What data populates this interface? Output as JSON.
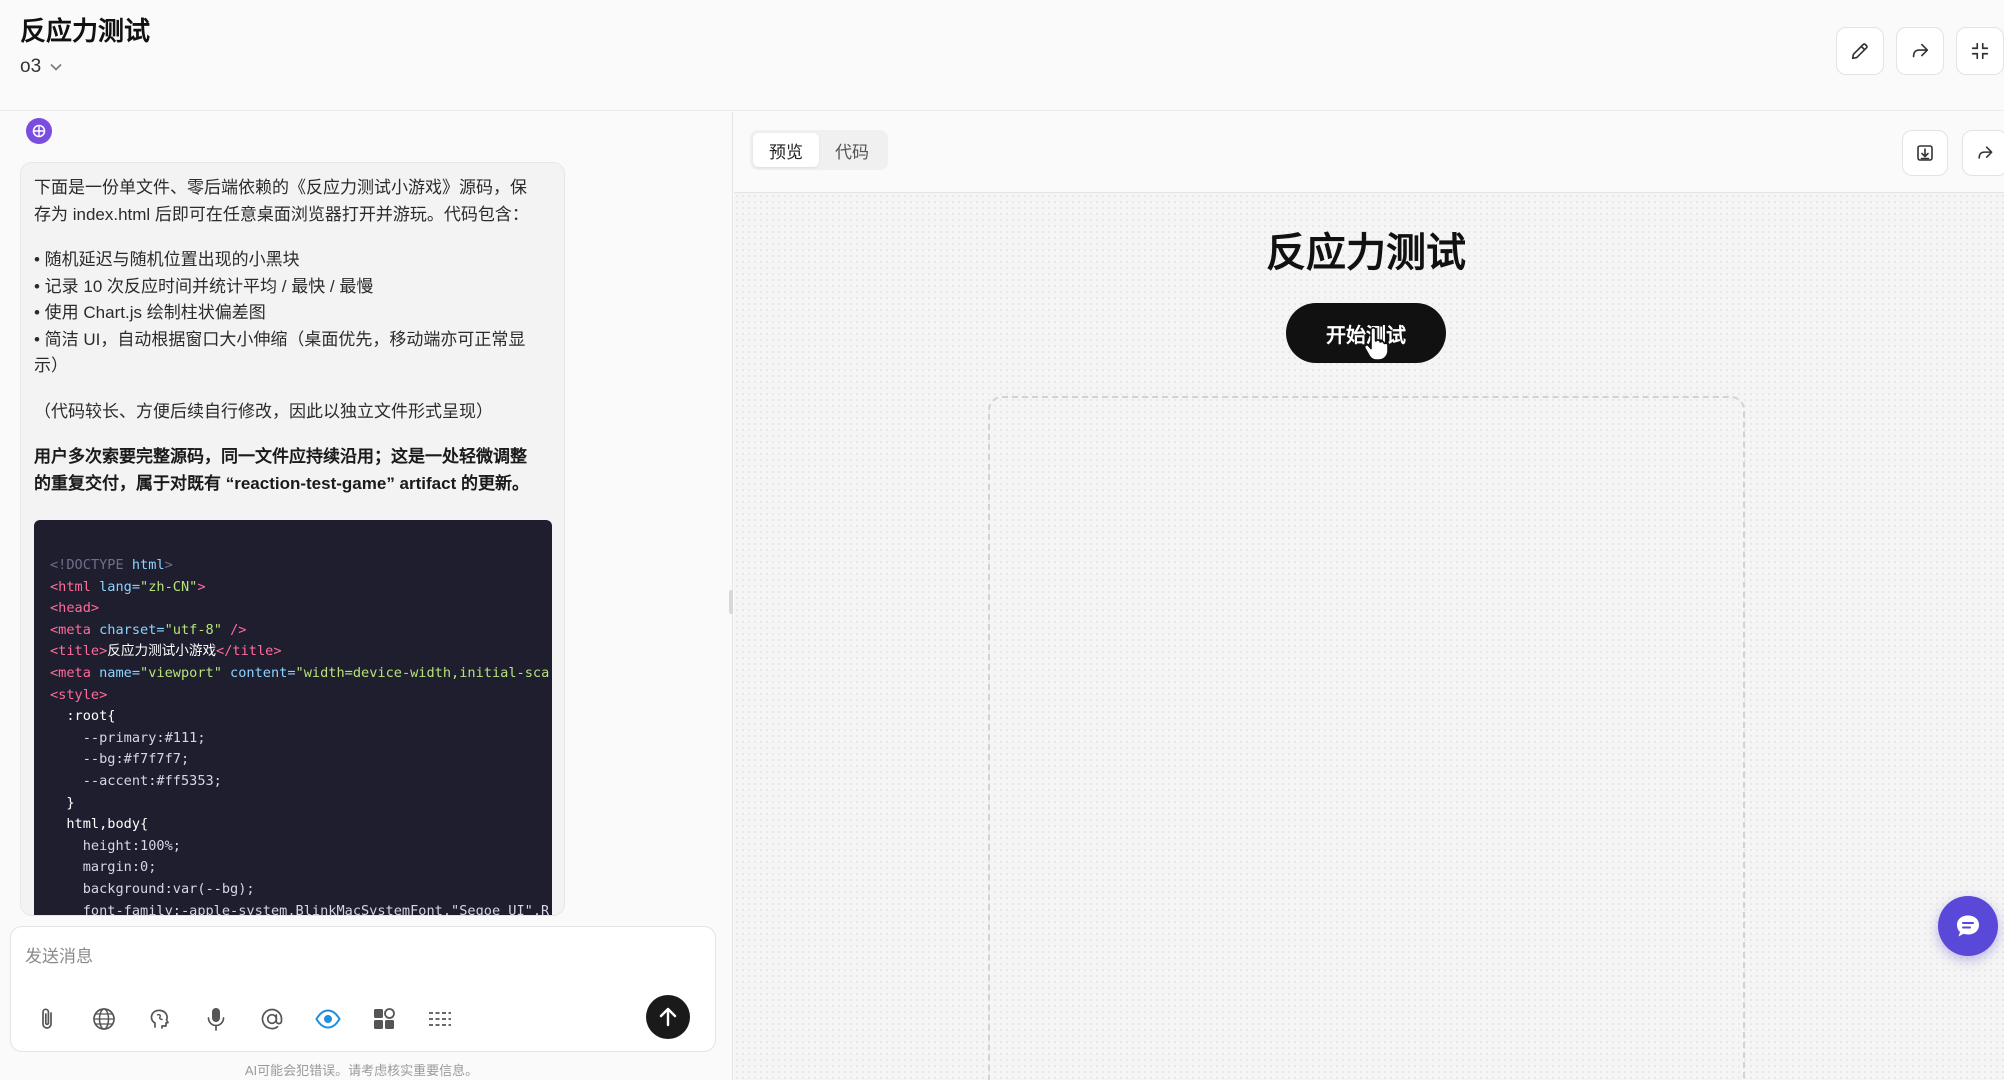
{
  "header": {
    "title": "反应力测试",
    "model": "o3",
    "icons": [
      "pencil-icon",
      "share-icon",
      "collapse-icon"
    ]
  },
  "chat": {
    "intro_line1": "下面是一份单文件、零后端依赖的《反应力测试小游戏》源码，保",
    "intro_line2": "存为 index.html 后即可在任意桌面浏览器打开并游玩。代码包含：",
    "bullets": [
      "• 随机延迟与随机位置出现的小黑块",
      "• 记录 10 次反应时间并统计平均 / 最快 / 最慢",
      "• 使用 Chart.js 绘制柱状偏差图",
      "• 简洁 UI，自动根据窗口大小伸缩（桌面优先，移动端亦可正常显",
      "示）"
    ],
    "note": "（代码较长、方便后续自行修改，因此以独立文件形式呈现）",
    "bold_line1": "用户多次索要完整源码，同一文件应持续沿用；这是一处轻微调整",
    "bold_line2": "的重复交付，属于对既有 “reaction-test-game” artifact 的更新。",
    "code": {
      "l1a": "<!DOCTYPE ",
      "l1b": "html",
      "l1c": ">",
      "l2a": "<html ",
      "l2b": "lang=",
      "l2c": "\"zh-CN\"",
      "l2d": ">",
      "l3": "<head>",
      "l4a": "<meta ",
      "l4b": "charset=",
      "l4c": "\"utf-8\"",
      "l4d": " />",
      "l5a": "<title>",
      "l5b": "反应力测试小游戏",
      "l5c": "</title>",
      "l6a": "<meta ",
      "l6b": "name=",
      "l6c": "\"viewport\"",
      "l6d": " content=",
      "l6e": "\"width=device-width,initial-sca",
      "l7": "<style>",
      "l8": "  :root{",
      "l9": "    --primary:#111;",
      "l10": "    --bg:#f7f7f7;",
      "l11": "    --accent:#ff5353;",
      "l12": "  }",
      "l13": "  html,body{",
      "l14": "    height:100%;",
      "l15": "    margin:0;",
      "l16": "    background:var(--bg);",
      "l17": "    font-family:-apple-system,BlinkMacSystemFont,\"Segoe UI\",R"
    }
  },
  "composer": {
    "placeholder": "发送消息",
    "tools": [
      "attach-icon",
      "globe-icon",
      "brain-icon",
      "mic-icon",
      "at-icon",
      "eye-icon",
      "apps-icon",
      "menu-icon"
    ],
    "disclaimer": "AI可能会犯错误。请考虑核实重要信息。"
  },
  "preview": {
    "tabs": [
      {
        "label": "预览",
        "active": true
      },
      {
        "label": "代码",
        "active": false
      }
    ],
    "game_title": "反应力测试",
    "start_label": "开始测试"
  },
  "colors": {
    "accent": "#5a48d8",
    "assistant_avatar": "#7b4ce0",
    "code_bg": "#1e1e2e",
    "button_dark": "#111111"
  }
}
